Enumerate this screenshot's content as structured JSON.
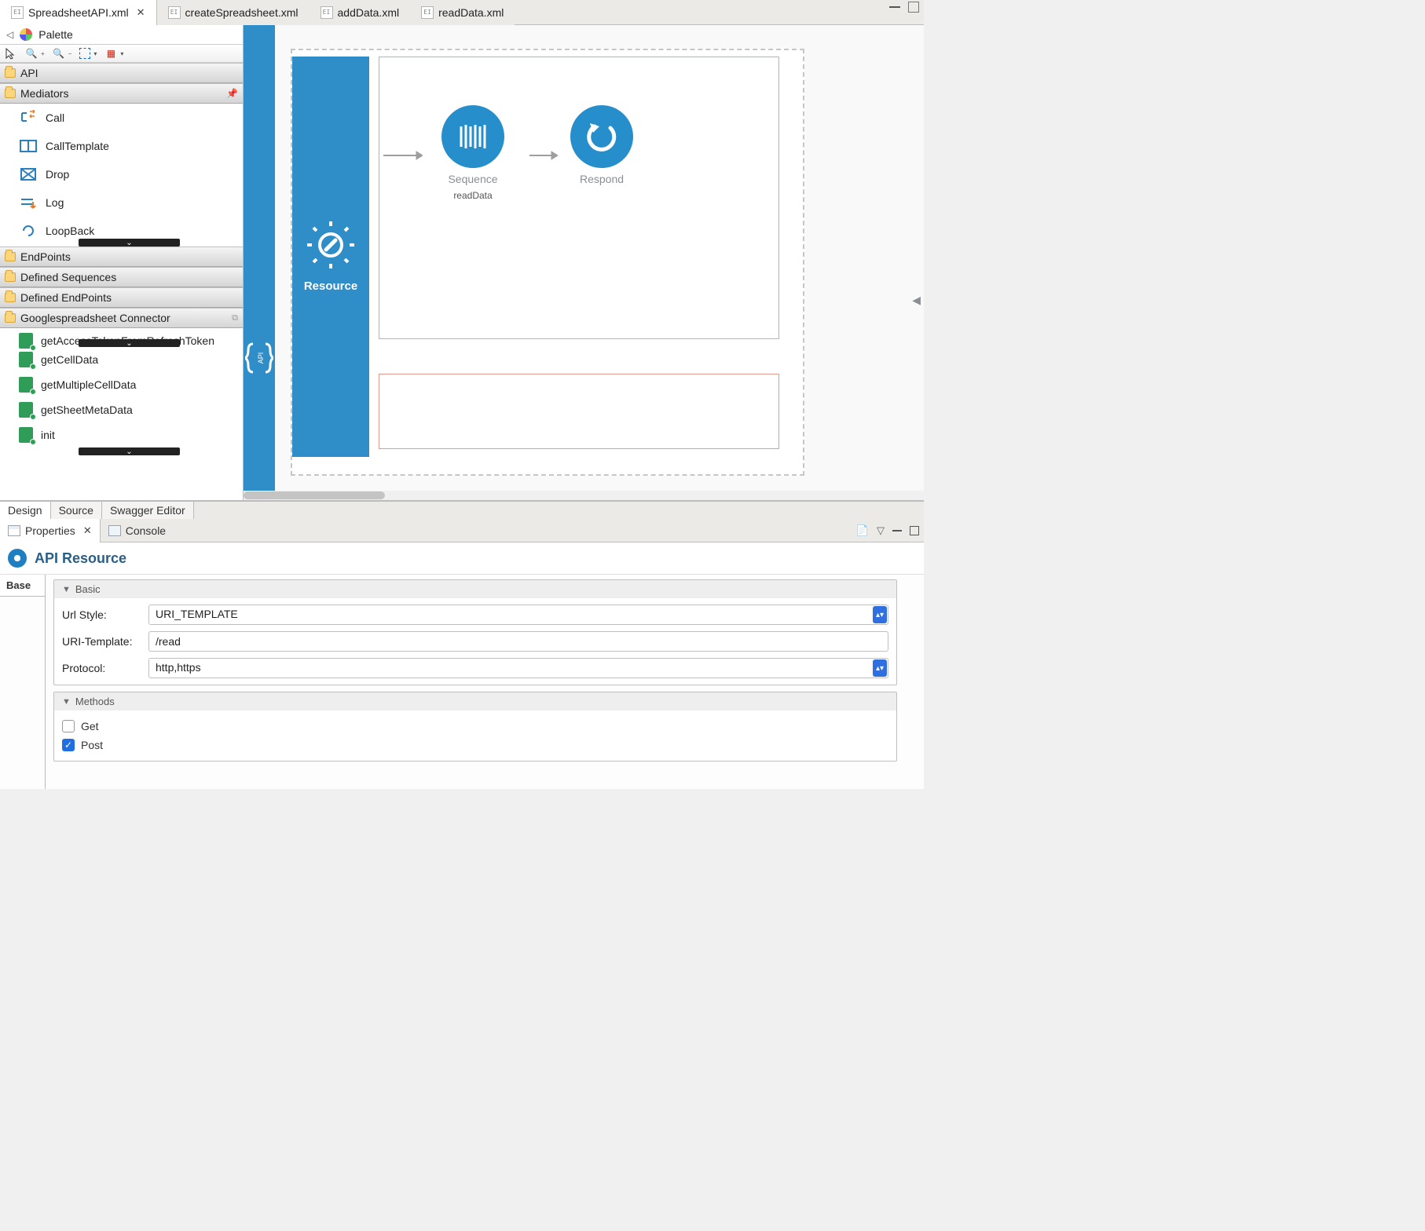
{
  "tabs": {
    "t1": {
      "label": "SpreadsheetAPI.xml",
      "active": true
    },
    "t2": {
      "label": "createSpreadsheet.xml"
    },
    "t3": {
      "label": "addData.xml"
    },
    "t4": {
      "label": "readData.xml"
    }
  },
  "palette": {
    "title": "Palette",
    "categories": {
      "api": "API",
      "mediators": "Mediators",
      "endpoints": "EndPoints",
      "defined_sequences": "Defined Sequences",
      "defined_endpoints": "Defined EndPoints",
      "google_connector": "Googlespreadsheet Connector"
    },
    "mediator_items": {
      "call": "Call",
      "call_template": "CallTemplate",
      "drop": "Drop",
      "log": "Log",
      "loopback": "LoopBack"
    },
    "connector_items": {
      "get_token": "getAccessTokenFromRefreshToken",
      "get_cell": "getCellData",
      "get_multi": "getMultipleCellData",
      "get_meta": "getSheetMetaData",
      "init": "init"
    }
  },
  "canvas": {
    "api_label": "API",
    "resource_label": "Resource",
    "node1": {
      "label": "Sequence",
      "sub": "readData"
    },
    "node2": {
      "label": "Respond"
    }
  },
  "mode_tabs": {
    "design": "Design",
    "source": "Source",
    "swagger": "Swagger Editor"
  },
  "lower": {
    "views": {
      "properties": "Properties",
      "console": "Console"
    },
    "header": "API Resource",
    "side": {
      "base": "Base"
    },
    "basic": {
      "title": "Basic",
      "url_style_label": "Url Style:",
      "url_style_value": "URI_TEMPLATE",
      "uri_template_label": "URI-Template:",
      "uri_template_value": "/read",
      "protocol_label": "Protocol:",
      "protocol_value": "http,https"
    },
    "methods": {
      "title": "Methods",
      "get": "Get",
      "post": "Post"
    }
  }
}
